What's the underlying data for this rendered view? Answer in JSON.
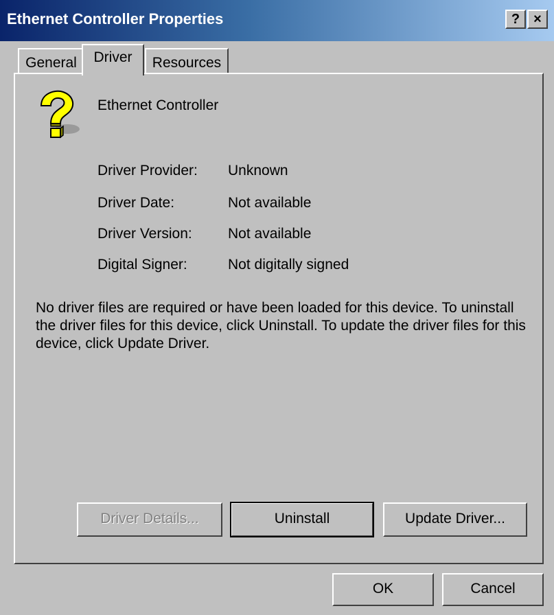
{
  "window": {
    "title": "Ethernet Controller Properties",
    "help_button": "?",
    "close_button": "×"
  },
  "tabs": [
    {
      "label": "General",
      "active": false
    },
    {
      "label": "Driver",
      "active": true
    },
    {
      "label": "Resources",
      "active": false
    }
  ],
  "device": {
    "icon": "unknown-device-question-icon",
    "name": "Ethernet Controller"
  },
  "driver_info": [
    {
      "label": "Driver Provider:",
      "value": "Unknown"
    },
    {
      "label": "Driver Date:",
      "value": "Not available"
    },
    {
      "label": "Driver Version:",
      "value": "Not available"
    },
    {
      "label": "Digital Signer:",
      "value": "Not digitally signed"
    }
  ],
  "description": "No driver files are required or have been loaded for this device. To uninstall the driver files for this device, click Uninstall. To update the driver files for this device, click Update Driver.",
  "buttons": {
    "driver_details": "Driver Details...",
    "uninstall": "Uninstall",
    "update_driver": "Update Driver..."
  },
  "dialog_buttons": {
    "ok": "OK",
    "cancel": "Cancel"
  },
  "colors": {
    "title_gradient_start": "#0a246a",
    "title_gradient_end": "#a6caf0",
    "face": "#c0c0c0",
    "icon_yellow": "#ffff00"
  }
}
